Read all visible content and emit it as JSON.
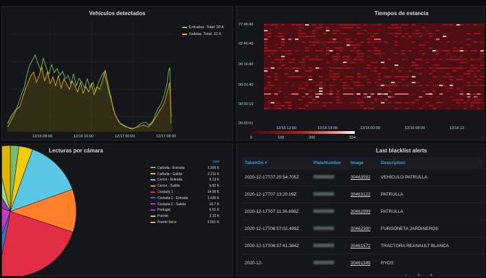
{
  "panels": {
    "vehicles": {
      "title": "Vehículos detectados",
      "legend": [
        {
          "label": "Entradas",
          "total": "Total: 30 K",
          "color": "#73bf69"
        },
        {
          "label": "Salidas",
          "total": "Total: 32 K",
          "color": "#e0b400"
        }
      ],
      "x_ticks": [
        "12/16 08:00",
        "12/16 16:00",
        "12/17 00:00",
        "12/17 08:00"
      ]
    },
    "stay": {
      "title": "Tiempos de estancia",
      "y_ticks": [
        "27:46:40",
        "02:46:40",
        "00:16:40",
        "00:01:40",
        "00:00:10",
        "00:00:01"
      ],
      "x_ticks": [
        "12/15 12:00",
        "12/15 18:00",
        "12/16 00:00",
        "12/16 06:00",
        "12/16 12"
      ],
      "scale_ticks": [
        "0",
        "100",
        "200",
        "334"
      ]
    },
    "readings": {
      "title": "Lecturas por cámara",
      "legend_header": "total",
      "legend": [
        {
          "label": "Cañada - Entrada",
          "value": "1.366 K",
          "color": "#73bf69"
        },
        {
          "label": "Cañada - Salida",
          "value": "2.211 K",
          "color": "#f2cc0c"
        },
        {
          "label": "Cexco - Entrada",
          "value": "9.13 K",
          "color": "#5ac8e4"
        },
        {
          "label": "Cexco - Salida",
          "value": "6.82 K",
          "color": "#ff7f2a"
        },
        {
          "label": "Coslada 1",
          "value": "14.90 K",
          "color": "#e02f44"
        },
        {
          "label": "Coslada 2 - Entrada",
          "value": "1.635 K",
          "color": "#3274d9"
        },
        {
          "label": "Coslada 2 - Salida",
          "value": "16.7 K",
          "color": "#c935c5"
        },
        {
          "label": "Portugal",
          "value": "6.51 K",
          "color": "#8f3bb8"
        },
        {
          "label": "Puente",
          "value": "3.10 K",
          "color": "#96d98d"
        },
        {
          "label": "Puerto Seco",
          "value": "2.551 K",
          "color": "#e0b400"
        }
      ]
    },
    "blacklist": {
      "title": "Last blacklist alerts",
      "columns": [
        "TakenOn",
        "PlateNumber",
        "Image",
        "Description"
      ],
      "rows": [
        {
          "taken": "2020-12-17T07:20:54.705Z",
          "image": "30463592",
          "desc": "VEHÍCULO PATRULLA"
        },
        {
          "taken": "2020-12-17T07:13:20.09Z",
          "image": "30463122",
          "desc": "PATRULLA"
        },
        {
          "taken": "2020-12-17T07:11:36.698Z",
          "image": "30462999",
          "desc": "PATRULLA"
        },
        {
          "taken": "2020-12-17T06:57:02.499Z",
          "image": "30462300",
          "desc": "FURGONETA JARDINEROS"
        },
        {
          "taken": "2020-12-17T06:37:41.384Z",
          "image": "30461572",
          "desc": "TRACTORA REANAULT BLANCA"
        },
        {
          "taken": "2020-12-",
          "image": "30461349",
          "desc": "RYOS"
        }
      ],
      "pages": [
        "1",
        "2",
        "3"
      ]
    }
  }
}
